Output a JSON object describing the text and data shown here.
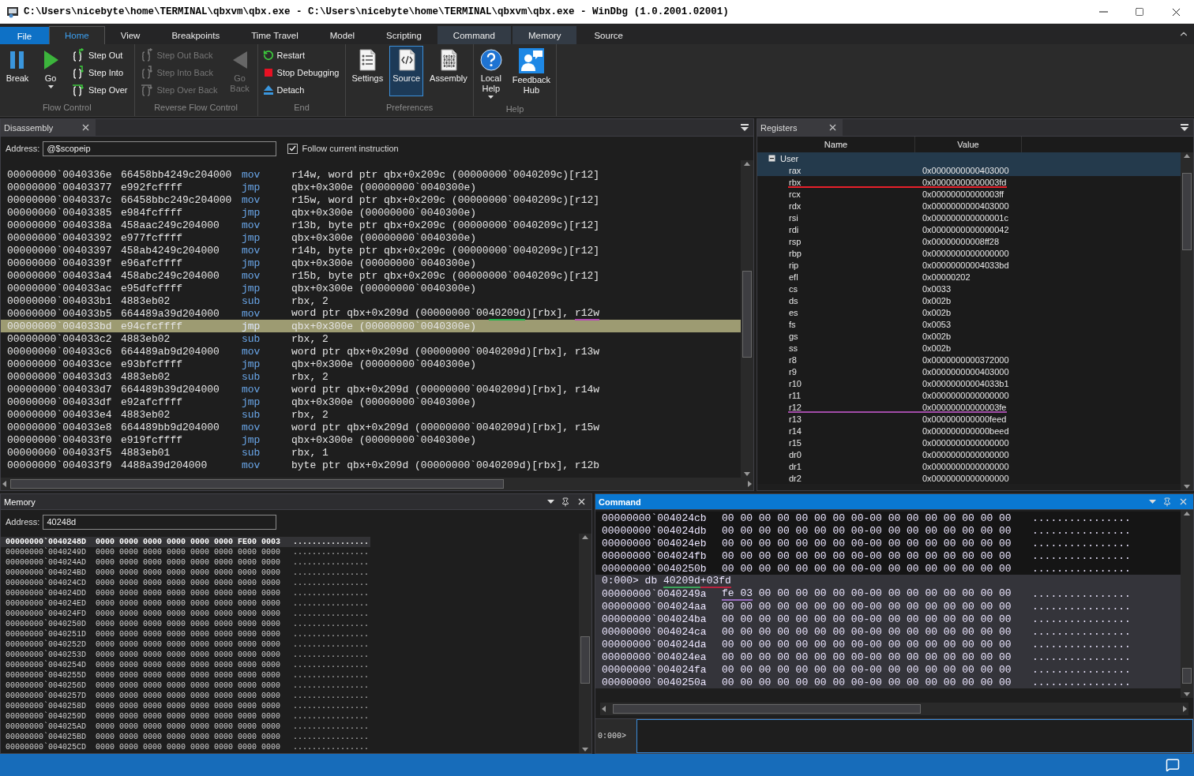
{
  "window": {
    "title": "C:\\Users\\nicebyte\\home\\TERMINAL\\qbxvm\\qbx.exe - C:\\Users\\nicebyte\\home\\TERMINAL\\qbxvm\\qbx.exe - WinDbg (1.0.2001.02001)"
  },
  "ribbon_tabs": [
    {
      "label": "File",
      "kind": "file",
      "selected": false
    },
    {
      "label": "Home",
      "kind": "normal",
      "selected": true
    },
    {
      "label": "View",
      "kind": "normal",
      "selected": false
    },
    {
      "label": "Breakpoints",
      "kind": "normal",
      "selected": false
    },
    {
      "label": "Time Travel",
      "kind": "normal",
      "selected": false
    },
    {
      "label": "Model",
      "kind": "normal",
      "selected": false
    },
    {
      "label": "Scripting",
      "kind": "normal",
      "selected": false
    },
    {
      "label": "Command",
      "kind": "contextual",
      "selected": false
    },
    {
      "label": "Memory",
      "kind": "contextual",
      "selected": false
    },
    {
      "label": "Source",
      "kind": "normal",
      "selected": false
    }
  ],
  "ribbon_groups": [
    {
      "label": "Flow Control",
      "items": [
        {
          "label": "Break",
          "kind": "large",
          "disabled": false,
          "selected": false,
          "dropdown": false
        },
        {
          "label": "Go",
          "kind": "large",
          "disabled": false,
          "selected": false,
          "dropdown": true
        },
        {
          "label": "Step Out",
          "kind": "small",
          "disabled": false,
          "selected": false,
          "dropdown": false
        },
        {
          "label": "Step Into",
          "kind": "small",
          "disabled": false,
          "selected": false,
          "dropdown": false
        },
        {
          "label": "Step Over",
          "kind": "small",
          "disabled": false,
          "selected": false,
          "dropdown": false
        }
      ]
    },
    {
      "label": "Reverse Flow Control",
      "items": [
        {
          "label": "Step Out Back",
          "kind": "small",
          "disabled": true,
          "selected": false,
          "dropdown": false
        },
        {
          "label": "Step Into Back",
          "kind": "small",
          "disabled": true,
          "selected": false,
          "dropdown": false
        },
        {
          "label": "Step Over Back",
          "kind": "small",
          "disabled": true,
          "selected": false,
          "dropdown": false
        },
        {
          "label": "Go Back",
          "kind": "large",
          "disabled": true,
          "selected": false,
          "dropdown": false
        }
      ]
    },
    {
      "label": "End",
      "items": [
        {
          "label": "Restart",
          "kind": "small",
          "disabled": false,
          "selected": false,
          "dropdown": false
        },
        {
          "label": "Stop Debugging",
          "kind": "small",
          "disabled": false,
          "selected": false,
          "dropdown": false
        },
        {
          "label": "Detach",
          "kind": "small",
          "disabled": false,
          "selected": false,
          "dropdown": false
        }
      ]
    },
    {
      "label": "Preferences",
      "items": [
        {
          "label": "Settings",
          "kind": "large",
          "disabled": false,
          "selected": false,
          "dropdown": false
        },
        {
          "label": "Source",
          "kind": "large",
          "disabled": false,
          "selected": true,
          "dropdown": false
        },
        {
          "label": "Assembly",
          "kind": "large",
          "disabled": false,
          "selected": false,
          "dropdown": false
        }
      ]
    },
    {
      "label": "Help",
      "items": [
        {
          "label": "Local Help",
          "kind": "large",
          "disabled": false,
          "selected": false,
          "dropdown": true
        },
        {
          "label": "Feedback Hub",
          "kind": "large",
          "disabled": false,
          "selected": false,
          "dropdown": false
        }
      ]
    }
  ],
  "disassembly": {
    "title": "Disassembly",
    "active": false,
    "address_label": "Address:",
    "address": "@$scopeip",
    "follow": {
      "label": "Follow current instruction",
      "checked": true
    },
    "rows": [
      {
        "address": "00000000`0040336e",
        "bytes": "66458bb4249c204000",
        "mnemonic": "mov",
        "operand": [
          {
            "text": "r14w, word ptr qbx+0x209c (00000000`0040209c)[r12]"
          }
        ],
        "selected": false
      },
      {
        "address": "00000000`00403377",
        "bytes": "e992fcffff",
        "mnemonic": "jmp",
        "operand": [
          {
            "text": "qbx+0x300e (00000000`0040300e)"
          }
        ],
        "selected": false
      },
      {
        "address": "00000000`0040337c",
        "bytes": "66458bbc249c204000",
        "mnemonic": "mov",
        "operand": [
          {
            "text": "r15w, word ptr qbx+0x209c (00000000`0040209c)[r12]"
          }
        ],
        "selected": false
      },
      {
        "address": "00000000`00403385",
        "bytes": "e984fcffff",
        "mnemonic": "jmp",
        "operand": [
          {
            "text": "qbx+0x300e (00000000`0040300e)"
          }
        ],
        "selected": false
      },
      {
        "address": "00000000`0040338a",
        "bytes": "458aac249c204000",
        "mnemonic": "mov",
        "operand": [
          {
            "text": "r13b, byte ptr qbx+0x209c (00000000`0040209c)[r12]"
          }
        ],
        "selected": false
      },
      {
        "address": "00000000`00403392",
        "bytes": "e977fcffff",
        "mnemonic": "jmp",
        "operand": [
          {
            "text": "qbx+0x300e (00000000`0040300e)"
          }
        ],
        "selected": false
      },
      {
        "address": "00000000`00403397",
        "bytes": "458ab4249c204000",
        "mnemonic": "mov",
        "operand": [
          {
            "text": "r14b, byte ptr qbx+0x209c (00000000`0040209c)[r12]"
          }
        ],
        "selected": false
      },
      {
        "address": "00000000`0040339f",
        "bytes": "e96afcffff",
        "mnemonic": "jmp",
        "operand": [
          {
            "text": "qbx+0x300e (00000000`0040300e)"
          }
        ],
        "selected": false
      },
      {
        "address": "00000000`004033a4",
        "bytes": "458abc249c204000",
        "mnemonic": "mov",
        "operand": [
          {
            "text": "r15b, byte ptr qbx+0x209c (00000000`0040209c)[r12]"
          }
        ],
        "selected": false
      },
      {
        "address": "00000000`004033ac",
        "bytes": "e95dfcffff",
        "mnemonic": "jmp",
        "operand": [
          {
            "text": "qbx+0x300e (00000000`0040300e)"
          }
        ],
        "selected": false
      },
      {
        "address": "00000000`004033b1",
        "bytes": "4883eb02",
        "mnemonic": "sub",
        "operand": [
          {
            "text": "rbx, 2"
          }
        ],
        "selected": false
      },
      {
        "address": "00000000`004033b5",
        "bytes": "664489a39d204000",
        "mnemonic": "mov",
        "operand": [
          {
            "text": "word ptr qbx+0x209d (00000000`00"
          },
          {
            "text": "40209d",
            "color": "#22b24c"
          },
          {
            "text": ")[rbx], "
          },
          {
            "text": "r12w",
            "color": "#b44bb4"
          }
        ],
        "selected": false
      },
      {
        "address": "00000000`004033bd",
        "bytes": "e94cfcffff",
        "mnemonic": "jmp",
        "operand": [
          {
            "text": "qbx+0x300e (00000000`0040300e)"
          }
        ],
        "selected": true
      },
      {
        "address": "00000000`004033c2",
        "bytes": "4883eb02",
        "mnemonic": "sub",
        "operand": [
          {
            "text": "rbx, 2"
          }
        ],
        "selected": false
      },
      {
        "address": "00000000`004033c6",
        "bytes": "664489ab9d204000",
        "mnemonic": "mov",
        "operand": [
          {
            "text": "word ptr qbx+0x209d (00000000`0040209d)[rbx], r13w"
          }
        ],
        "selected": false
      },
      {
        "address": "00000000`004033ce",
        "bytes": "e93bfcffff",
        "mnemonic": "jmp",
        "operand": [
          {
            "text": "qbx+0x300e (00000000`0040300e)"
          }
        ],
        "selected": false
      },
      {
        "address": "00000000`004033d3",
        "bytes": "4883eb02",
        "mnemonic": "sub",
        "operand": [
          {
            "text": "rbx, 2"
          }
        ],
        "selected": false
      },
      {
        "address": "00000000`004033d7",
        "bytes": "664489b39d204000",
        "mnemonic": "mov",
        "operand": [
          {
            "text": "word ptr qbx+0x209d (00000000`0040209d)[rbx], r14w"
          }
        ],
        "selected": false
      },
      {
        "address": "00000000`004033df",
        "bytes": "e92afcffff",
        "mnemonic": "jmp",
        "operand": [
          {
            "text": "qbx+0x300e (00000000`0040300e)"
          }
        ],
        "selected": false
      },
      {
        "address": "00000000`004033e4",
        "bytes": "4883eb02",
        "mnemonic": "sub",
        "operand": [
          {
            "text": "rbx, 2"
          }
        ],
        "selected": false
      },
      {
        "address": "00000000`004033e8",
        "bytes": "664489bb9d204000",
        "mnemonic": "mov",
        "operand": [
          {
            "text": "word ptr qbx+0x209d (00000000`0040209d)[rbx], r15w"
          }
        ],
        "selected": false
      },
      {
        "address": "00000000`004033f0",
        "bytes": "e919fcffff",
        "mnemonic": "jmp",
        "operand": [
          {
            "text": "qbx+0x300e (00000000`0040300e)"
          }
        ],
        "selected": false
      },
      {
        "address": "00000000`004033f5",
        "bytes": "4883eb01",
        "mnemonic": "sub",
        "operand": [
          {
            "text": "rbx, 1"
          }
        ],
        "selected": false
      },
      {
        "address": "00000000`004033f9",
        "bytes": "4488a39d204000",
        "mnemonic": "mov",
        "operand": [
          {
            "text": "byte ptr qbx+0x209d (00000000`0040209d)[rbx], r12b"
          }
        ],
        "selected": false
      }
    ]
  },
  "registers": {
    "title": "Registers",
    "active": false,
    "columns": [
      "Name",
      "Value"
    ],
    "groups": [
      {
        "name": "User",
        "expanded": true,
        "selected": true,
        "registers": [
          {
            "name": "rax",
            "value": "0x0000000000403000",
            "selected": true
          },
          {
            "name": "rbx",
            "value": "0x00000000000003fd",
            "selected": false,
            "color": "#e8202a"
          },
          {
            "name": "rcx",
            "value": "0x00000000000003ff",
            "selected": false
          },
          {
            "name": "rdx",
            "value": "0x0000000000403000",
            "selected": false
          },
          {
            "name": "rsi",
            "value": "0x000000000000001c",
            "selected": false
          },
          {
            "name": "rdi",
            "value": "0x0000000000000042",
            "selected": false
          },
          {
            "name": "rsp",
            "value": "0x00000000008ff28",
            "selected": false
          },
          {
            "name": "rbp",
            "value": "0x0000000000000000",
            "selected": false
          },
          {
            "name": "rip",
            "value": "0x00000000004033bd",
            "selected": false
          },
          {
            "name": "efl",
            "value": "0x00000202",
            "selected": false
          },
          {
            "name": "cs",
            "value": "0x0033",
            "selected": false
          },
          {
            "name": "ds",
            "value": "0x002b",
            "selected": false
          },
          {
            "name": "es",
            "value": "0x002b",
            "selected": false
          },
          {
            "name": "fs",
            "value": "0x0053",
            "selected": false
          },
          {
            "name": "gs",
            "value": "0x002b",
            "selected": false
          },
          {
            "name": "ss",
            "value": "0x002b",
            "selected": false
          },
          {
            "name": "r8",
            "value": "0x0000000000372000",
            "selected": false
          },
          {
            "name": "r9",
            "value": "0x0000000000403000",
            "selected": false
          },
          {
            "name": "r10",
            "value": "0x00000000004033b1",
            "selected": false
          },
          {
            "name": "r11",
            "value": "0x0000000000000000",
            "selected": false
          },
          {
            "name": "r12",
            "value": "0x00000000000003fe",
            "selected": false,
            "color": "#a24ca8"
          },
          {
            "name": "r13",
            "value": "0x000000000000feed",
            "selected": false
          },
          {
            "name": "r14",
            "value": "0x000000000000beed",
            "selected": false
          },
          {
            "name": "r15",
            "value": "0x0000000000000000",
            "selected": false
          },
          {
            "name": "dr0",
            "value": "0x0000000000000000",
            "selected": false
          },
          {
            "name": "dr1",
            "value": "0x0000000000000000",
            "selected": false
          },
          {
            "name": "dr2",
            "value": "0x0000000000000000",
            "selected": false
          }
        ]
      }
    ]
  },
  "memory": {
    "title": "Memory",
    "active": false,
    "address_label": "Address:",
    "address": "40248d",
    "rows": [
      {
        "address": "00000000`0040248D",
        "words": "0000 0000 0000 0000 0000 0000 FE00 0003",
        "ascii": "................",
        "selected": true
      },
      {
        "address": "00000000`0040249D",
        "words": "0000 0000 0000 0000 0000 0000 0000 0000",
        "ascii": "................",
        "selected": false
      },
      {
        "address": "00000000`004024AD",
        "words": "0000 0000 0000 0000 0000 0000 0000 0000",
        "ascii": "................",
        "selected": false
      },
      {
        "address": "00000000`004024BD",
        "words": "0000 0000 0000 0000 0000 0000 0000 0000",
        "ascii": "................",
        "selected": false
      },
      {
        "address": "00000000`004024CD",
        "words": "0000 0000 0000 0000 0000 0000 0000 0000",
        "ascii": "................",
        "selected": false
      },
      {
        "address": "00000000`004024DD",
        "words": "0000 0000 0000 0000 0000 0000 0000 0000",
        "ascii": "................",
        "selected": false
      },
      {
        "address": "00000000`004024ED",
        "words": "0000 0000 0000 0000 0000 0000 0000 0000",
        "ascii": "................",
        "selected": false
      },
      {
        "address": "00000000`004024FD",
        "words": "0000 0000 0000 0000 0000 0000 0000 0000",
        "ascii": "................",
        "selected": false
      },
      {
        "address": "00000000`0040250D",
        "words": "0000 0000 0000 0000 0000 0000 0000 0000",
        "ascii": "................",
        "selected": false
      },
      {
        "address": "00000000`0040251D",
        "words": "0000 0000 0000 0000 0000 0000 0000 0000",
        "ascii": "................",
        "selected": false
      },
      {
        "address": "00000000`0040252D",
        "words": "0000 0000 0000 0000 0000 0000 0000 0000",
        "ascii": "................",
        "selected": false
      },
      {
        "address": "00000000`0040253D",
        "words": "0000 0000 0000 0000 0000 0000 0000 0000",
        "ascii": "................",
        "selected": false
      },
      {
        "address": "00000000`0040254D",
        "words": "0000 0000 0000 0000 0000 0000 0000 0000",
        "ascii": "................",
        "selected": false
      },
      {
        "address": "00000000`0040255D",
        "words": "0000 0000 0000 0000 0000 0000 0000 0000",
        "ascii": "................",
        "selected": false
      },
      {
        "address": "00000000`0040256D",
        "words": "0000 0000 0000 0000 0000 0000 0000 0000",
        "ascii": "................",
        "selected": false
      },
      {
        "address": "00000000`0040257D",
        "words": "0000 0000 0000 0000 0000 0000 0000 0000",
        "ascii": "................",
        "selected": false
      },
      {
        "address": "00000000`0040258D",
        "words": "0000 0000 0000 0000 0000 0000 0000 0000",
        "ascii": "................",
        "selected": false
      },
      {
        "address": "00000000`0040259D",
        "words": "0000 0000 0000 0000 0000 0000 0000 0000",
        "ascii": "................",
        "selected": false
      },
      {
        "address": "00000000`004025AD",
        "words": "0000 0000 0000 0000 0000 0000 0000 0000",
        "ascii": "................",
        "selected": false
      },
      {
        "address": "00000000`004025BD",
        "words": "0000 0000 0000 0000 0000 0000 0000 0000",
        "ascii": "................",
        "selected": false
      },
      {
        "address": "00000000`004025CD",
        "words": "0000 0000 0000 0000 0000 0000 0000 0000",
        "ascii": "................",
        "selected": false
      }
    ]
  },
  "command": {
    "title": "Command",
    "active": true,
    "prompt": "0:000>",
    "lines": [
      {
        "kind": "dump",
        "address": "00000000`004024cb",
        "bytes": [
          {
            "text": "00 00 00 00 00 00 00 00-00 00 00 00 00 00 00 00"
          }
        ],
        "ascii": "................",
        "highlighted": false
      },
      {
        "kind": "dump",
        "address": "00000000`004024db",
        "bytes": [
          {
            "text": "00 00 00 00 00 00 00 00-00 00 00 00 00 00 00 00"
          }
        ],
        "ascii": "................",
        "highlighted": false
      },
      {
        "kind": "dump",
        "address": "00000000`004024eb",
        "bytes": [
          {
            "text": "00 00 00 00 00 00 00 00-00 00 00 00 00 00 00 00"
          }
        ],
        "ascii": "................",
        "highlighted": false
      },
      {
        "kind": "dump",
        "address": "00000000`004024fb",
        "bytes": [
          {
            "text": "00 00 00 00 00 00 00 00-00 00 00 00 00 00 00 00"
          }
        ],
        "ascii": "................",
        "highlighted": false
      },
      {
        "kind": "dump",
        "address": "00000000`0040250b",
        "bytes": [
          {
            "text": "00 00 00 00 00 00 00 00-00 00 00 00 00 00 00 00"
          }
        ],
        "ascii": "................",
        "highlighted": false
      },
      {
        "kind": "command",
        "parts": [
          {
            "text": "0:000> db "
          },
          {
            "text": "40209d",
            "color": "#3aa35a"
          },
          {
            "text": "+03fd",
            "color": "#b8233f"
          }
        ],
        "highlighted": true
      },
      {
        "kind": "dump",
        "address": "00000000`0040249a",
        "bytes": [
          {
            "text": "fe 03",
            "color": "#9a6cc0"
          },
          {
            "text": " 00 00 00 00 00 00-00 00 00 00 00 00 00 00"
          }
        ],
        "ascii": "................",
        "highlighted": true
      },
      {
        "kind": "dump",
        "address": "00000000`004024aa",
        "bytes": [
          {
            "text": "00 00 00 00 00 00 00 00-00 00 00 00 00 00 00 00"
          }
        ],
        "ascii": "................",
        "highlighted": true
      },
      {
        "kind": "dump",
        "address": "00000000`004024ba",
        "bytes": [
          {
            "text": "00 00 00 00 00 00 00 00-00 00 00 00 00 00 00 00"
          }
        ],
        "ascii": "................",
        "highlighted": true
      },
      {
        "kind": "dump",
        "address": "00000000`004024ca",
        "bytes": [
          {
            "text": "00 00 00 00 00 00 00 00-00 00 00 00 00 00 00 00"
          }
        ],
        "ascii": "................",
        "highlighted": true
      },
      {
        "kind": "dump",
        "address": "00000000`004024da",
        "bytes": [
          {
            "text": "00 00 00 00 00 00 00 00-00 00 00 00 00 00 00 00"
          }
        ],
        "ascii": "................",
        "highlighted": true
      },
      {
        "kind": "dump",
        "address": "00000000`004024ea",
        "bytes": [
          {
            "text": "00 00 00 00 00 00 00 00-00 00 00 00 00 00 00 00"
          }
        ],
        "ascii": "................",
        "highlighted": true
      },
      {
        "kind": "dump",
        "address": "00000000`004024fa",
        "bytes": [
          {
            "text": "00 00 00 00 00 00 00 00-00 00 00 00 00 00 00 00"
          }
        ],
        "ascii": "................",
        "highlighted": true
      },
      {
        "kind": "dump",
        "address": "00000000`0040250a",
        "bytes": [
          {
            "text": "00 00 00 00 00 00 00 00-00 00 00 00 00 00 00 00"
          }
        ],
        "ascii": "................",
        "highlighted": true
      }
    ]
  }
}
